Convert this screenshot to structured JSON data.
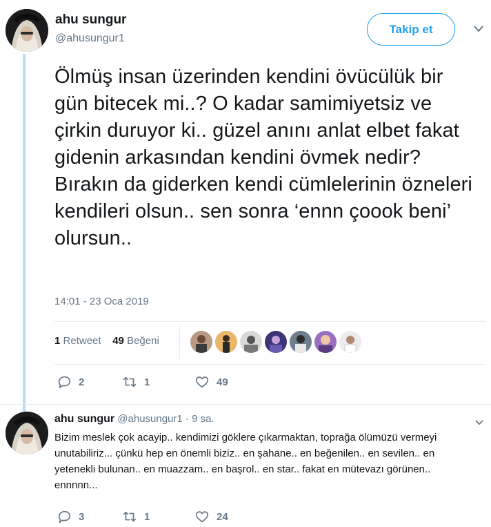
{
  "tweet": {
    "author_name": "ahu sungur",
    "author_handle": "@ahusungur1",
    "follow_label": "Takip et",
    "text": "Ölmüş insan üzerinden kendini övücülük bir gün bitecek mi..? O kadar samimiyetsiz ve çirkin duruyor ki.. güzel anını anlat elbet fakat gidenin arkasından kendini övmek nedir? Bırakın da giderken kendi cümlelerinin özneleri kendileri olsun.. sen sonra ‘ennn çoook beni’ olursun..",
    "timestamp": "14:01 - 23 Oca 2019",
    "retweet_count": "1",
    "retweet_label": "Retweet",
    "like_count": "49",
    "like_label": "Beğeni",
    "actions": {
      "replies": "2",
      "retweets": "1",
      "likes": "49"
    }
  },
  "reply": {
    "author_name": "ahu sungur",
    "author_handle": "@ahusungur1",
    "time": "· 9 sa.",
    "text": "Bizim meslek çok acayip.. kendimizi göklere çıkarmaktan, toprağa ölümüzü vermeyi unutabiliriz... çünkü hep en önemli biziz.. en şahane.. en beğenilen.. en sevilen.. en yetenekli bulunan.. en muazzam.. en başrol.. en star.. fakat en mütevazı görünen.. ennnnn...",
    "actions": {
      "replies": "3",
      "retweets": "1",
      "likes": "24"
    }
  },
  "colors": {
    "accent": "#1da1f2",
    "muted": "#657786",
    "thread_line": "#b7dcf5",
    "divider": "#e6ecf0"
  },
  "icons": [
    "chevron-down-icon",
    "reply-icon",
    "retweet-icon",
    "heart-icon"
  ]
}
